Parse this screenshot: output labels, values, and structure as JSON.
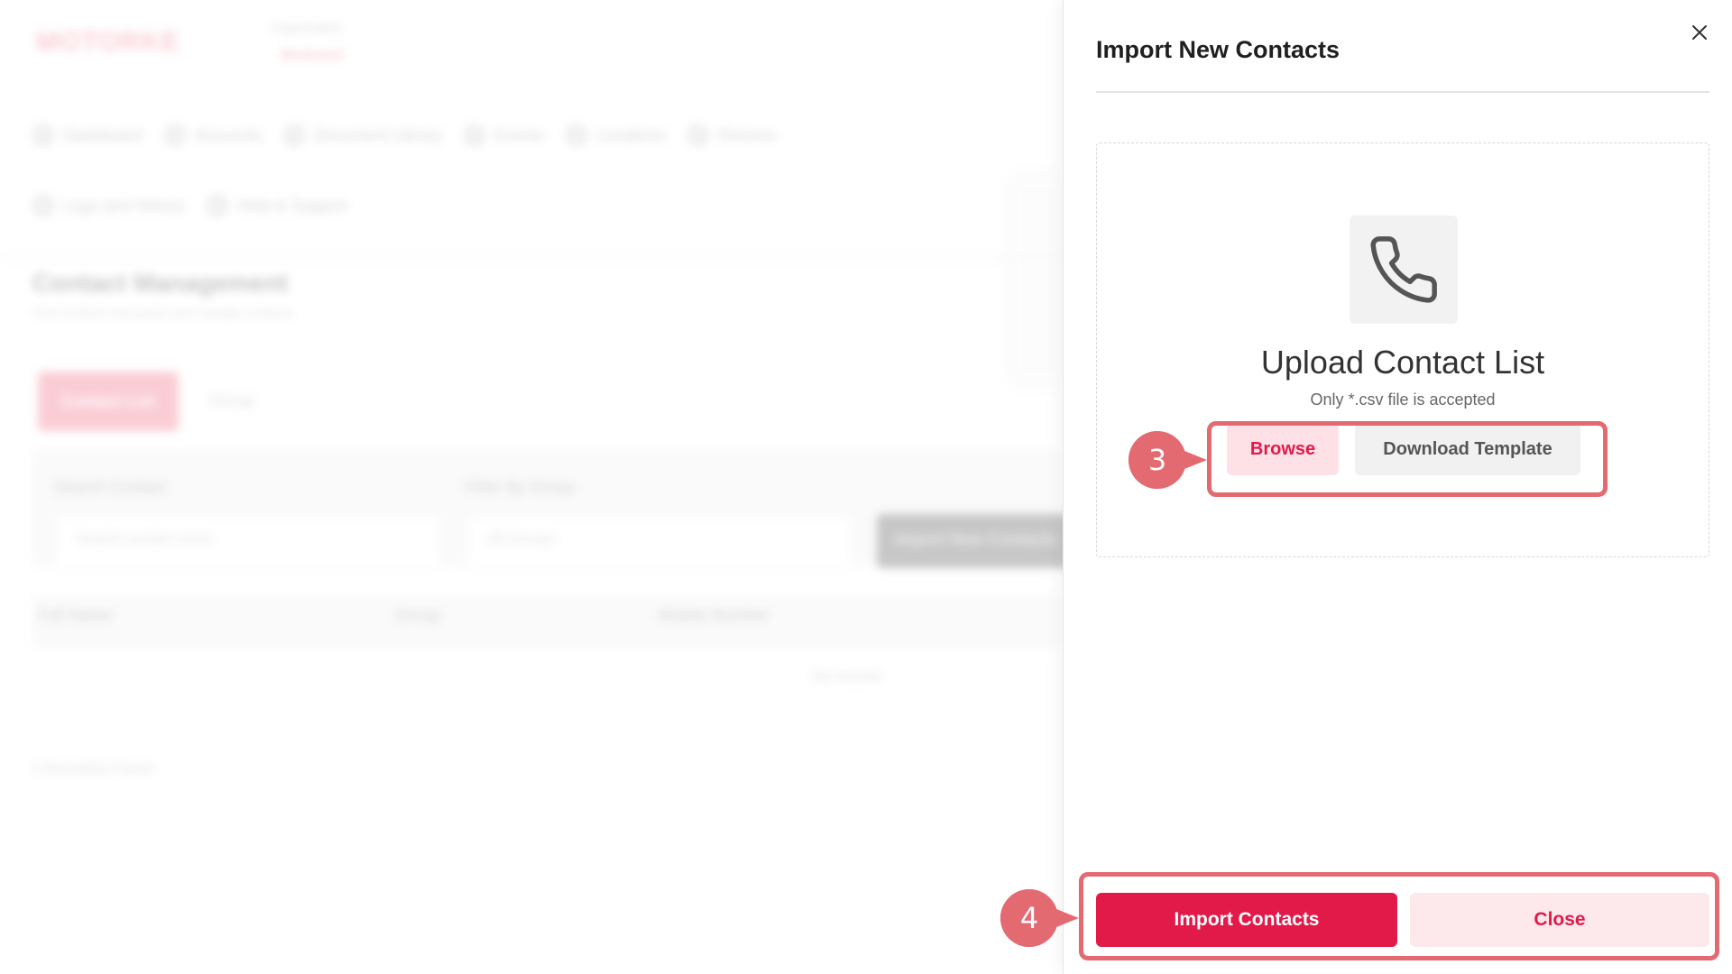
{
  "background": {
    "logo_text": "MOTORKE",
    "org_label": "Organization",
    "org_name": "Boulevard",
    "nav_row1": [
      "Dashboard",
      "Accounts",
      "Document Library",
      "Events",
      "Locations",
      "Devices"
    ],
    "nav_row2": [
      "Logs and History",
      "Help & Support"
    ],
    "page_title": "Contact Management",
    "page_subtitle": "Find contacts and group and manage contacts",
    "tabs": [
      "Contact List",
      "Group"
    ],
    "search_label": "Search Contact",
    "search_placeholder": "Search contact name",
    "filter_label": "Filter By Group",
    "filter_value": "All Groups",
    "import_button": "Import New Contacts",
    "columns": [
      "Full Name",
      "Group",
      "Mobile Number"
    ],
    "empty_text": "No records",
    "footer_text": "0 Record(s) Found"
  },
  "drawer": {
    "title": "Import New Contacts",
    "upload_title": "Upload Contact List",
    "upload_subtitle": "Only *.csv file is accepted",
    "browse_label": "Browse",
    "template_label": "Download Template",
    "import_label": "Import Contacts",
    "close_label": "Close",
    "icons": {
      "close": "close-icon",
      "upload": "phone-icon"
    }
  },
  "annotations": {
    "step_a": "3",
    "step_b": "4",
    "color": "#e46a72"
  },
  "colors": {
    "accent": "#e21a4a",
    "accent_soft": "#fde1e6"
  }
}
